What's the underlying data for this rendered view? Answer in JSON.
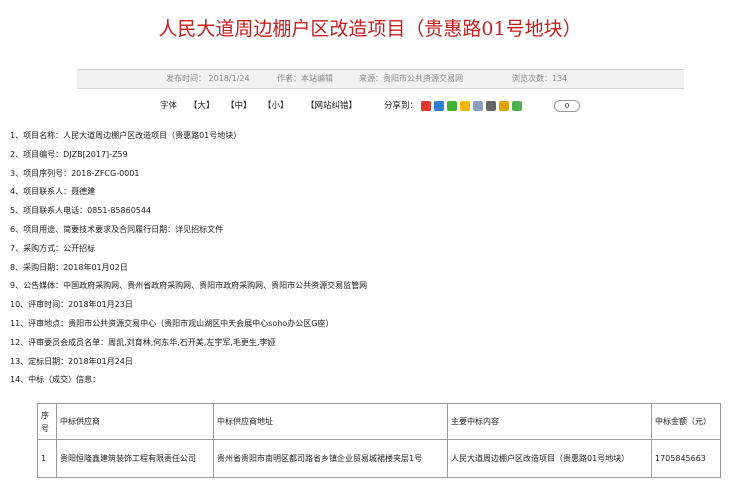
{
  "article": {
    "title": "人民大道周边棚户区改造项目（贵惠路01号地块）"
  },
  "meta": {
    "publish_time": "发布时间：  2018/1/24",
    "author": "作者：本站编辑",
    "source": "来源：贵阳市公共资源交易网",
    "views": "浏览次数：134"
  },
  "tools": {
    "font_label": "字体",
    "size_large": "【大】",
    "size_medium": "【中】",
    "size_small": "【小】",
    "correction": "【网站纠错】",
    "share_label": "分享到：",
    "share_count": "0",
    "share_icons": [
      {
        "name": "sina-weibo-icon",
        "color": "#e0382b"
      },
      {
        "name": "qzone-icon",
        "color": "#2e7fd6"
      },
      {
        "name": "wechat-icon",
        "color": "#41b035"
      },
      {
        "name": "favorite-star-icon",
        "color": "#f2b600"
      },
      {
        "name": "copy-icon",
        "color": "#8aa0c0"
      },
      {
        "name": "print-icon",
        "color": "#666666"
      },
      {
        "name": "email-icon",
        "color": "#e0a000"
      },
      {
        "name": "more-plus-icon",
        "color": "#4caf50"
      }
    ]
  },
  "items": [
    "1、项目名称：人民大道周边棚户区改造项目（贵惠路01号地块）",
    "2、项目编号：DJZB[2017]-Z59",
    "3、项目序列号：2018-ZFCG-0001",
    "4、项目联系人：聂德建",
    "5、项目联系人电话：0851-85860544",
    "6、项目用途、简要技术要求及合同履行日期：详见招标文件",
    "7、采购方式：公开招标",
    "8、采购日期：2018年01月02日",
    "9、公告媒体：中国政府采购网、贵州省政府采购网、贵阳市政府采购网、贵阳市公共资源交易监管网",
    "10、评审时间：2018年01月23日",
    "11、评审地点：贵阳市公共资源交易中心（贵阳市观山湖区中天会展中心soho办公区G座）",
    "12、评审委员会成员名单：周凯,刘育林,何东华,石开美,左宇军,毛更生,李娅",
    "13、定标日期：2018年01月24日",
    "14、中标（成交）信息："
  ],
  "table": {
    "headers": [
      "序号",
      "中标供应商",
      "中标供应商地址",
      "主要中标内容",
      "中标金额（元）"
    ],
    "rows": [
      [
        "1",
        "贵阳恒隆鑫建筑装饰工程有限责任公司",
        "贵州省贵阳市南明区都司路省乡镇企业贸易城裙楼夹层1号",
        "人民大道周边棚户区改造项目（贵惠路01号地块）",
        "1705845663"
      ]
    ]
  }
}
